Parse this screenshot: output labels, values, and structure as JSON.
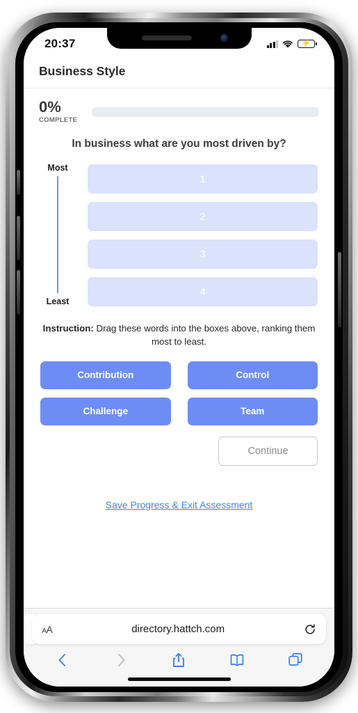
{
  "status_bar": {
    "time": "20:37",
    "signal_icon": "cellular-signal-icon",
    "wifi_icon": "wifi-icon",
    "battery_icon": "battery-charging-icon",
    "battery_color": "#f7c31a"
  },
  "page": {
    "title": "Business Style"
  },
  "progress": {
    "percent_label": "0%",
    "complete_label": "COMPLETE",
    "value": 0,
    "track_color": "#e9ecef",
    "bar_color": "#6d8df5"
  },
  "question": {
    "text": "In business what are you most driven by?"
  },
  "scale": {
    "top_label": "Most",
    "bottom_label": "Least",
    "line_color": "#6d8df5"
  },
  "ranking_slots": [
    {
      "number": "1"
    },
    {
      "number": "2"
    },
    {
      "number": "3"
    },
    {
      "number": "4"
    }
  ],
  "instruction": {
    "label": "Instruction:",
    "text": "Drag these words into the boxes above, ranking them most to least."
  },
  "word_chips": [
    {
      "label": "Contribution"
    },
    {
      "label": "Control"
    },
    {
      "label": "Challenge"
    },
    {
      "label": "Team"
    }
  ],
  "chip_color": "#6d8df5",
  "slot_color": "#dbe2fb",
  "continue": {
    "label": "Continue"
  },
  "save_link": {
    "label": "Save Progress & Exit Assessment",
    "color": "#3d84f7"
  },
  "browser": {
    "aa_label": "A",
    "aa_label_small": "A",
    "url": "directory.hattch.com",
    "reload_icon": "reload-icon",
    "toolbar": [
      {
        "name": "back-button",
        "icon": "chevron-left-icon",
        "enabled": true
      },
      {
        "name": "forward-button",
        "icon": "chevron-right-icon",
        "enabled": false
      },
      {
        "name": "share-button",
        "icon": "share-icon",
        "enabled": true
      },
      {
        "name": "bookmarks-button",
        "icon": "book-icon",
        "enabled": true
      },
      {
        "name": "tabs-button",
        "icon": "tabs-icon",
        "enabled": true
      }
    ]
  }
}
